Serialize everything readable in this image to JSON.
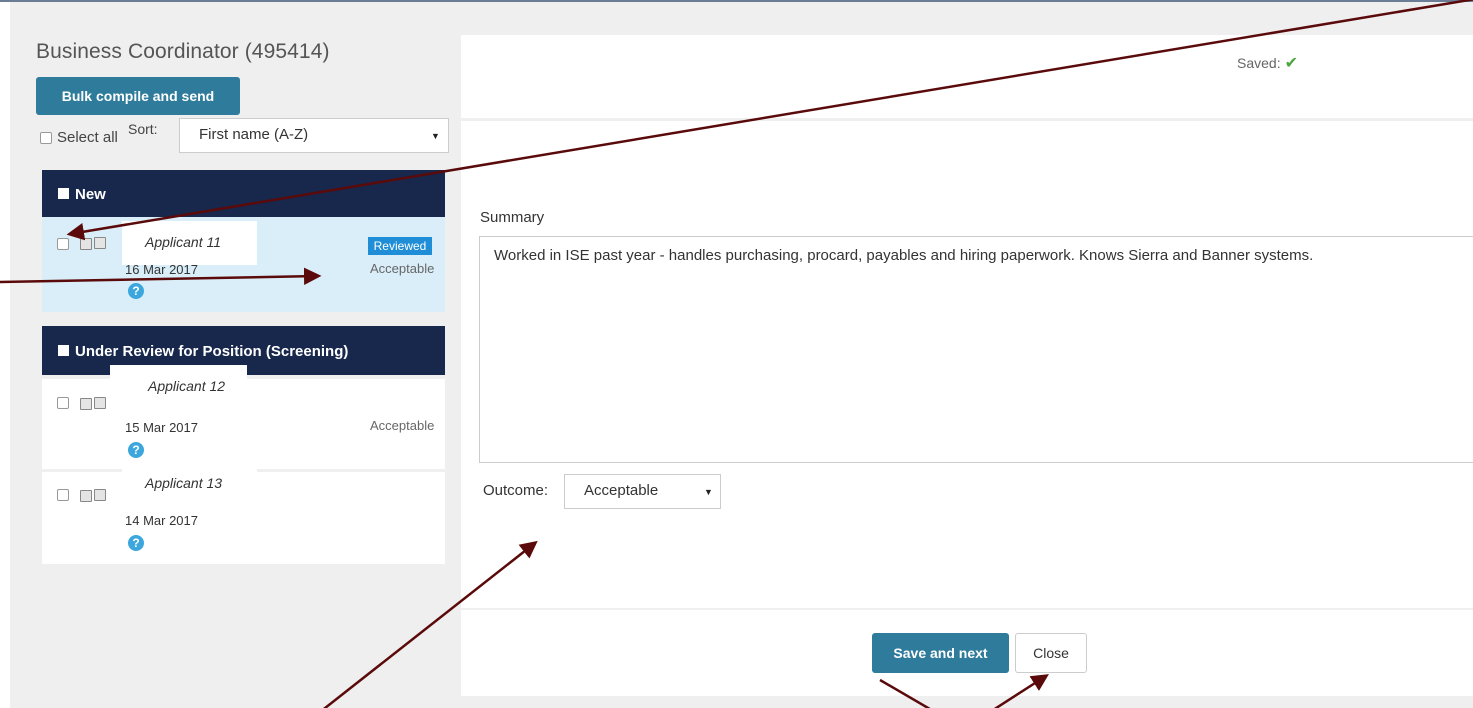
{
  "page": {
    "title": "Business Coordinator (495414)"
  },
  "toolbar": {
    "bulk_label": "Bulk compile and send",
    "select_all_label": "Select all",
    "sort_label": "Sort:",
    "sort_value": "First name (A-Z)"
  },
  "groups": [
    {
      "label": "New",
      "applicants": [
        {
          "name": "Applicant 11",
          "date": "16 Mar 2017",
          "status_badge": "Reviewed",
          "outcome": "Acceptable"
        }
      ]
    },
    {
      "label": "Under Review for Position (Screening)",
      "applicants": [
        {
          "name": "Applicant 12",
          "date": "15 Mar 2017",
          "outcome": "Acceptable"
        },
        {
          "name": "Applicant 13",
          "date": "14 Mar 2017",
          "outcome": ""
        }
      ]
    }
  ],
  "detail": {
    "saved_label": "Saved:",
    "summary_label": "Summary",
    "summary_text": "Worked in ISE past year - handles purchasing, procard, payables and hiring paperwork.  Knows Sierra and Banner systems.",
    "outcome_label": "Outcome:",
    "outcome_value": "Acceptable",
    "save_next_label": "Save and next",
    "close_label": "Close"
  },
  "colors": {
    "primary_button": "#2e7b9c",
    "group_header": "#17284c",
    "selected_row": "#d9eef9",
    "badge": "#1f8ed6",
    "help_icon": "#3ba7dd",
    "saved_check": "#4aa63d",
    "annotation_arrow": "#5a0a0a"
  },
  "icons": {
    "help": "question-circle-icon",
    "saved": "checkmark-icon",
    "select_caret": "caret-down-icon",
    "document": "document-icon",
    "copy": "copy-icon"
  }
}
